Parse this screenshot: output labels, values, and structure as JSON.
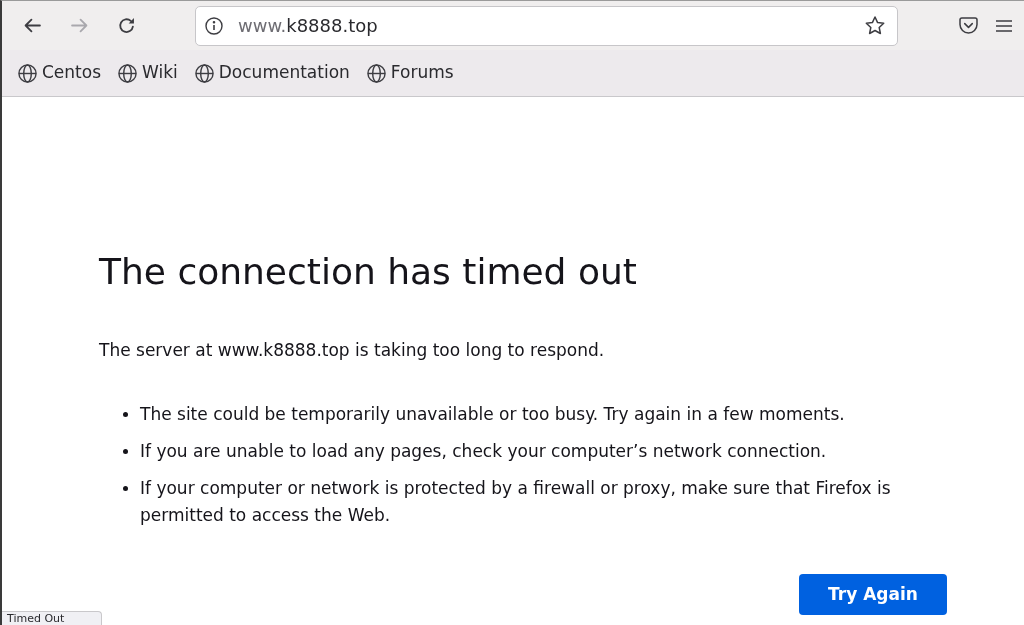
{
  "toolbar": {
    "back": {
      "disabled": false
    },
    "forward": {
      "disabled": true
    },
    "address_bar": {
      "prefix": "www.",
      "domain": "k8888.top"
    }
  },
  "bookmarks": [
    "Centos",
    "Wiki",
    "Documentation",
    "Forums"
  ],
  "error_page": {
    "title": "The connection has timed out",
    "description": "The server at www.k8888.top is taking too long to respond.",
    "bullets": [
      "The site could be temporarily unavailable or too busy. Try again in a few moments.",
      "If you are unable to load any pages, check your computer’s network connection.",
      "If your computer or network is protected by a firewall or proxy, make sure that Firefox is permitted to access the Web."
    ],
    "button": "Try Again"
  },
  "status": "Timed Out"
}
